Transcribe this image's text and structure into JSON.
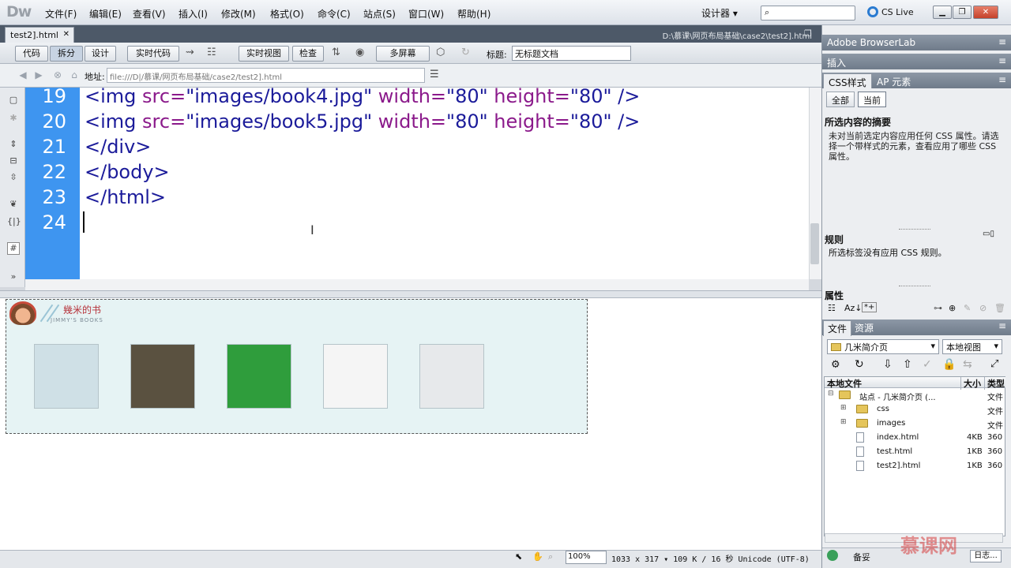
{
  "app": {
    "logo": "Dw",
    "layout_mode": "设计器 ▾",
    "cs_live": "CS Live"
  },
  "menu": [
    "文件(F)",
    "编辑(E)",
    "查看(V)",
    "插入(I)",
    "修改(M)",
    "格式(O)",
    "命令(C)",
    "站点(S)",
    "窗口(W)",
    "帮助(H)"
  ],
  "document": {
    "tab": "test2].html",
    "path": "D:\\慕课\\网页布局基础\\case2\\test2].html",
    "toolbar": {
      "code": "代码",
      "split": "拆分",
      "design": "设计",
      "live_code": "实时代码",
      "live_view": "实时视图",
      "inspect": "检查",
      "multiscreen": "多屏幕",
      "title_label": "标题:",
      "title_value": "无标题文档"
    },
    "address_label": "地址:",
    "address_value": "file:///D|/慕课/网页布局基础/case2/test2].html"
  },
  "code": {
    "line_numbers": [
      "19",
      "20",
      "21",
      "22",
      "23",
      "24"
    ],
    "lines": [
      {
        "tag": "<img ",
        "a1": "src=",
        "v1": "\"images/book4.jpg\" ",
        "a2": "width=",
        "v2": "\"80\" ",
        "a3": "height=",
        "v3": "\"80\" />"
      },
      {
        "tag": "<img ",
        "a1": "src=",
        "v1": "\"images/book5.jpg\" ",
        "a2": "width=",
        "v2": "\"80\" ",
        "a3": "height=",
        "v3": "\"80\" />"
      },
      {
        "text": "</div>"
      },
      {
        "text": "</body>"
      },
      {
        "text": "</html>"
      }
    ]
  },
  "design": {
    "site_title": "幾米的书",
    "site_subtitle": "JIMMY'S  BOOKS",
    "book_colors": [
      "#cfe0e6",
      "#5a5140",
      "#2f9d3c",
      "#f5f5f5",
      "#e7e9eb"
    ]
  },
  "status": {
    "zoom": "100%",
    "info": "1033 x 317 ▾  109 K / 16 秒  Unicode (UTF-8)"
  },
  "panels": {
    "browserlab": "Adobe BrowserLab",
    "insert": "插入",
    "css_tab": "CSS样式",
    "ap_tab": "AP 元素",
    "all_btn": "全部",
    "current_btn": "当前",
    "summary_title": "所选内容的摘要",
    "summary_text": "未对当前选定内容应用任何 CSS 属性。请选择一个带样式的元素，查看应用了哪些 CSS 属性。",
    "rules_title": "规则",
    "rules_text": "所选标签没有应用 CSS 规则。",
    "props_title": "属性",
    "files_tab": "文件",
    "assets_tab": "资源",
    "site_select": "几米简介页",
    "view_select": "本地视图",
    "file_headers": [
      "本地文件",
      "大小",
      "类型"
    ],
    "files": [
      {
        "name": "站点 - 几米简介页 (...",
        "size": "",
        "type": "文件",
        "kind": "site",
        "indent": 0
      },
      {
        "name": "css",
        "size": "",
        "type": "文件",
        "kind": "folder",
        "indent": 1
      },
      {
        "name": "images",
        "size": "",
        "type": "文件",
        "kind": "folder",
        "indent": 1
      },
      {
        "name": "index.html",
        "size": "4KB",
        "type": "360",
        "kind": "file",
        "indent": 1
      },
      {
        "name": "test.html",
        "size": "1KB",
        "type": "360",
        "kind": "file",
        "indent": 1
      },
      {
        "name": "test2].html",
        "size": "1KB",
        "type": "360",
        "kind": "file",
        "indent": 1
      }
    ],
    "bottom_backup": "备妥",
    "bottom_log": "日志...",
    "watermark": "慕课网"
  }
}
